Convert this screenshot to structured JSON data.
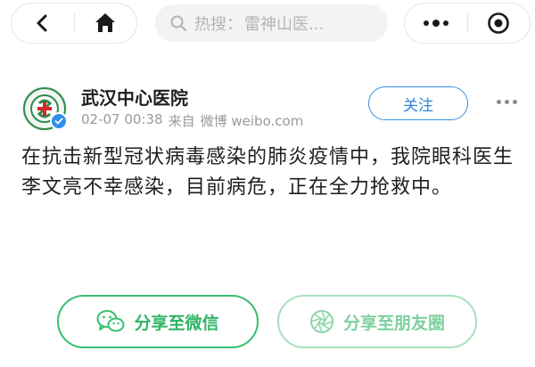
{
  "nav": {
    "search_label": "热搜：",
    "search_term": "雷神山医..."
  },
  "post": {
    "author": "武汉中心医院",
    "date": "02-07 00:38",
    "source_prefix": "来自",
    "source": "微博 weibo.com",
    "follow_label": "关注",
    "text": "在抗击新型冠状病毒感染的肺炎疫情中，我院眼科医生李文亮不幸感染，目前病危，正在全力抢救中。"
  },
  "share": {
    "wechat_label": "分享至微信",
    "moments_label": "分享至朋友圈"
  },
  "colors": {
    "accent_blue": "#2f86dc",
    "wechat_green": "#2fb566",
    "moments_green": "#7fd09f"
  }
}
